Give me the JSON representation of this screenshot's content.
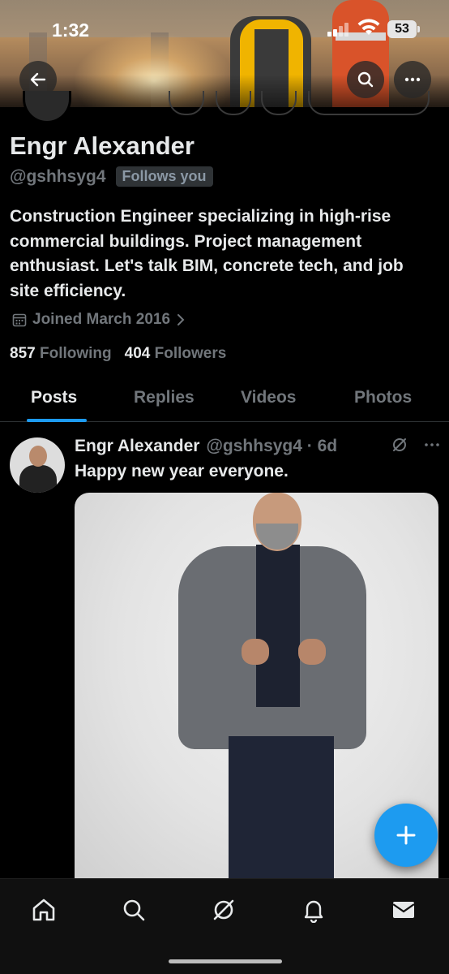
{
  "status_bar": {
    "time": "1:32",
    "battery": "53"
  },
  "profile": {
    "name": "Engr Alexander",
    "handle": "@gshhsyg4",
    "follows_badge": "Follows you",
    "bio": "Construction Engineer specializing in high-rise commercial buildings. Project management enthusiast. Let's talk BIM, concrete tech, and job site efficiency.",
    "joined": "Joined March 2016",
    "following_count": "857",
    "following_label": "Following",
    "followers_count": "404",
    "followers_label": "Followers"
  },
  "tabs": [
    {
      "label": "Posts",
      "active": true
    },
    {
      "label": "Replies",
      "active": false
    },
    {
      "label": "Videos",
      "active": false
    },
    {
      "label": "Photos",
      "active": false
    }
  ],
  "post": {
    "author": "Engr Alexander",
    "meta": "@gshhsyg4 · 6d",
    "text": "Happy new year everyone."
  },
  "colors": {
    "accent": "#1d9bf0",
    "background": "#000000",
    "muted": "#71767b"
  },
  "icons": [
    "back-arrow-icon",
    "search-icon",
    "more-icon",
    "calendar-icon",
    "chevron-right-icon",
    "grok-icon",
    "post-more-icon",
    "compose-plus-icon",
    "home-icon",
    "search-nav-icon",
    "grok-nav-icon",
    "notifications-icon",
    "messages-icon"
  ]
}
